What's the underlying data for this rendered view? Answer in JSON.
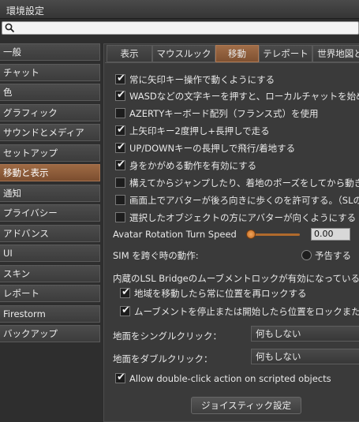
{
  "window": {
    "title": "環境設定"
  },
  "search": {
    "placeholder": "",
    "value": ""
  },
  "sidebar": {
    "items": [
      {
        "label": "一般"
      },
      {
        "label": "チャット"
      },
      {
        "label": "色"
      },
      {
        "label": "グラフィック"
      },
      {
        "label": "サウンドとメディア"
      },
      {
        "label": "セットアップ"
      },
      {
        "label": "移動と表示",
        "active": true
      },
      {
        "label": "通知"
      },
      {
        "label": "プライバシー"
      },
      {
        "label": "アドバンス"
      },
      {
        "label": "UI"
      },
      {
        "label": "スキン"
      },
      {
        "label": "レポート"
      },
      {
        "label": "Firestorm"
      },
      {
        "label": "バックアップ"
      }
    ]
  },
  "tabs": [
    {
      "label": "表示"
    },
    {
      "label": "マウスルック"
    },
    {
      "label": "移動",
      "active": true
    },
    {
      "label": "テレポート"
    },
    {
      "label": "世界地図と"
    }
  ],
  "checkboxes": [
    {
      "label": "常に矢印キー操作で動くようにする",
      "checked": true
    },
    {
      "label": "WASDなどの文字キーを押すと、ローカルチャットを始める",
      "checked": true
    },
    {
      "label": "AZERTYキーボード配列（フランス式）を使用",
      "checked": false
    },
    {
      "label": "上矢印キー2度押し+長押しで走る",
      "checked": true
    },
    {
      "label": "UP/DOWNキーの長押しで飛行/着地する",
      "checked": true
    },
    {
      "label": "身をかがめる動作を有効にする",
      "checked": true
    },
    {
      "label": "構えてからジャンプしたり、着地のポーズをしてから動き出",
      "checked": false
    },
    {
      "label": "画面上でアバターが後ろ向きに歩くのを許可する。（SLのゲ",
      "checked": false
    },
    {
      "label": "選択したオブジェクトの方にアバターが向くようにする",
      "checked": false
    }
  ],
  "rotation": {
    "label": "Avatar Rotation Turn Speed",
    "value": "0.00",
    "level": 0
  },
  "sim": {
    "label": "SIM を跨ぐ時の動作:",
    "option": "予告する"
  },
  "lsl": {
    "label": "内蔵のLSL Bridgeのムーブメントロックが有効になっている場",
    "options": [
      {
        "label": "地域を移動したら常に位置を再ロックする",
        "checked": true
      },
      {
        "label": "ムーブメントを停止または開始したら位置をロックまたは",
        "checked": true
      }
    ]
  },
  "single_click": {
    "label": "地面をシングルクリック：",
    "value": "何もしない"
  },
  "double_click": {
    "label": "地面をダブルクリック：",
    "value": "何もしない"
  },
  "scripted": {
    "label": "Allow double-click action on scripted objects",
    "checked": true
  },
  "joystick": {
    "label": "ジョイスティック設定"
  }
}
